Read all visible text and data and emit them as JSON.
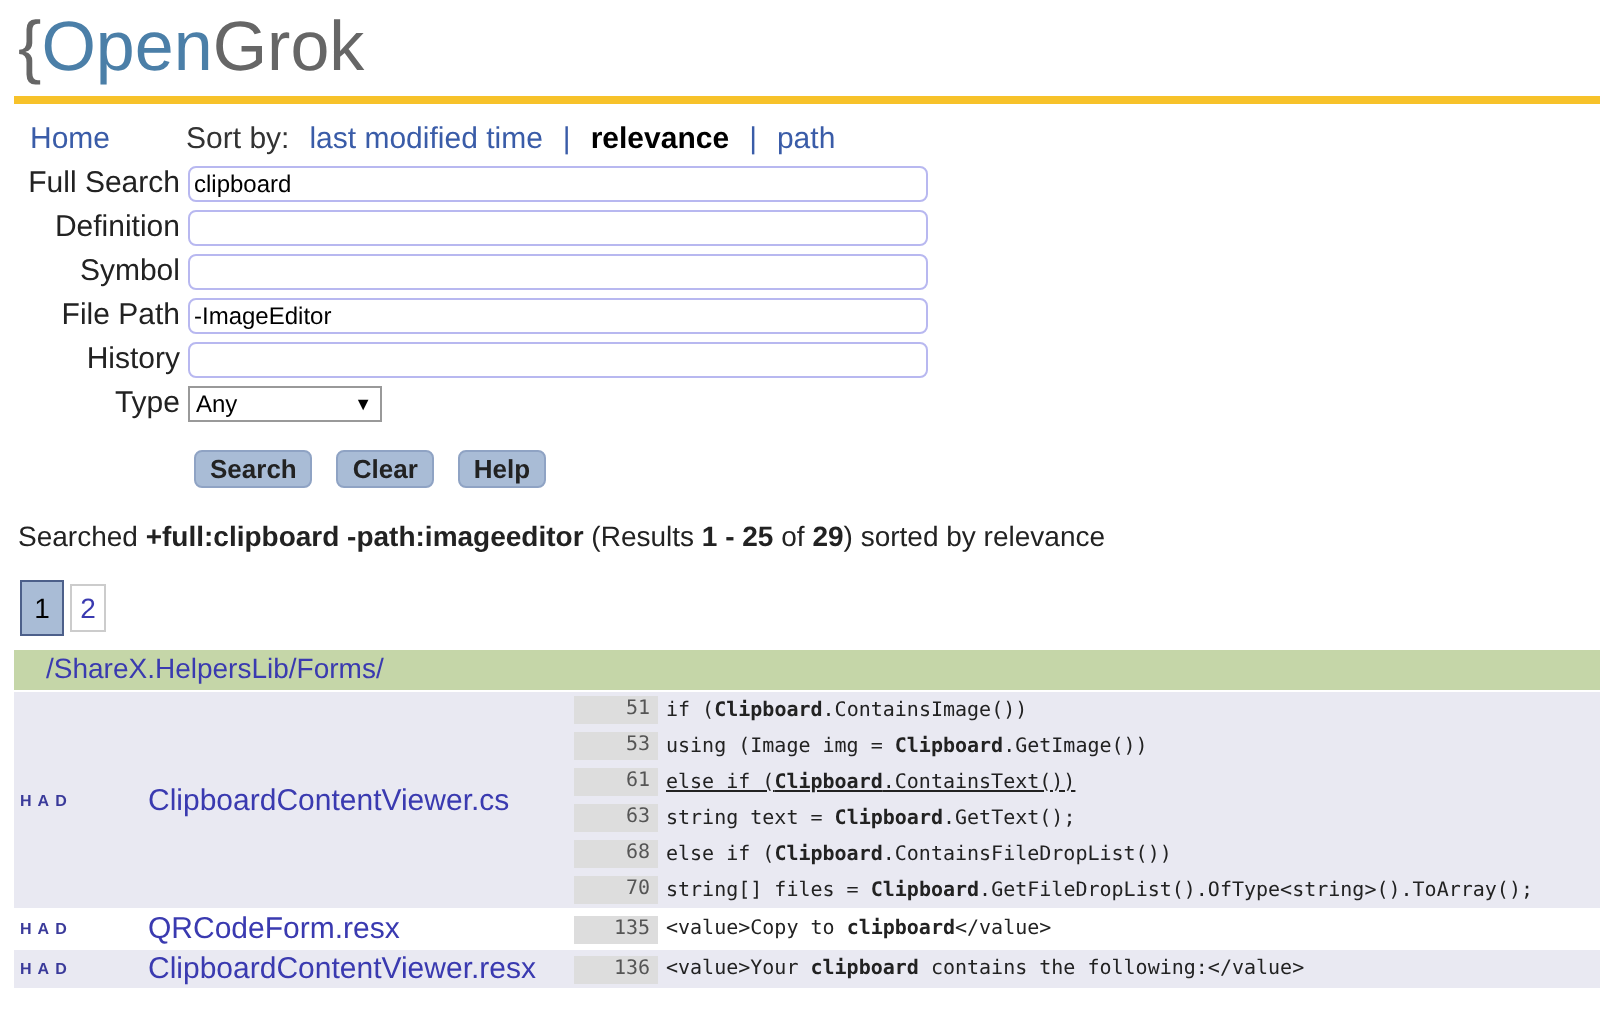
{
  "logo": {
    "brace": "{",
    "open": "Open",
    "grok": "Grok"
  },
  "nav": {
    "home": "Home",
    "sort_label": "Sort by:",
    "sort_options": [
      {
        "label": "last modified time",
        "selected": false
      },
      {
        "label": "relevance",
        "selected": true
      },
      {
        "label": "path",
        "selected": false
      }
    ],
    "separator": "|"
  },
  "form": {
    "fields": [
      {
        "label": "Full Search",
        "value": "clipboard"
      },
      {
        "label": "Definition"
      },
      {
        "label": "Symbol"
      },
      {
        "label": "File Path",
        "value": "-ImageEditor"
      },
      {
        "label": "History"
      }
    ],
    "type": {
      "label": "Type",
      "value": "Any",
      "caret": "▼"
    },
    "buttons": [
      "Search",
      "Clear",
      "Help"
    ]
  },
  "summary": "Searched **+full:clipboard -path:imageeditor** (Results **1 - 25** of **29**) sorted by relevance",
  "pages": [
    {
      "label": "1",
      "selected": true
    },
    {
      "label": "2",
      "selected": false
    }
  ],
  "results": {
    "directory": "/ShareX.HelpersLib/Forms/",
    "rows": [
      {
        "tags": [
          "H",
          "A",
          "D"
        ],
        "file": "ClipboardContentViewer.cs",
        "lines": [
          {
            "number": "51",
            "code": "if (**Clipboard**.ContainsImage())",
            "hovered": false
          },
          {
            "number": "53",
            "code": "using (Image img = **Clipboard**.GetImage())",
            "hovered": false
          },
          {
            "number": "61",
            "code": "else if (**Clipboard**.ContainsText())",
            "hovered": true
          },
          {
            "number": "63",
            "code": "string text = **Clipboard**.GetText();",
            "hovered": false
          },
          {
            "number": "68",
            "code": "else if (**Clipboard**.ContainsFileDropList())",
            "hovered": false
          },
          {
            "number": "70",
            "code": "string[] files = **Clipboard**.GetFileDropList().OfType<string>().ToArray();",
            "hovered": false
          }
        ]
      },
      {
        "tags": [
          "H",
          "A",
          "D"
        ],
        "file": "QRCodeForm.resx",
        "lines": [
          {
            "number": "135",
            "code": "<value>Copy to **clipboard**</value>",
            "hovered": false
          }
        ]
      },
      {
        "tags": [
          "H",
          "A",
          "D"
        ],
        "file": "ClipboardContentViewer.resx",
        "lines": [
          {
            "number": "136",
            "code": "<value>Your **clipboard** contains the following:</value>",
            "hovered": false
          }
        ]
      }
    ]
  }
}
